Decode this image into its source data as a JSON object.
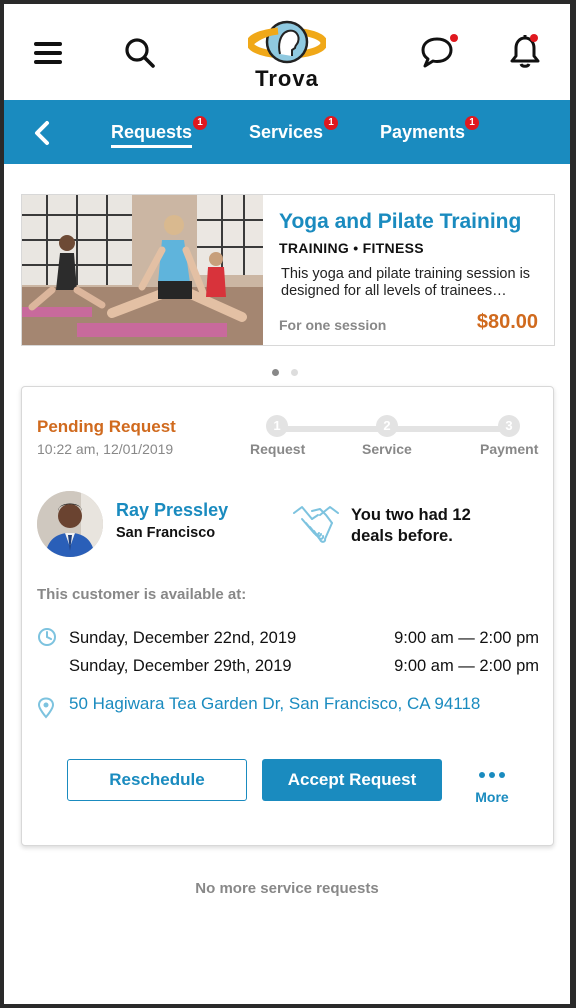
{
  "header": {
    "brand": "Trova",
    "icons": [
      "menu-icon",
      "search-icon",
      "chat-icon",
      "bell-icon"
    ],
    "chat_has_notification": true,
    "bell_has_notification": true
  },
  "nav": {
    "tabs": [
      {
        "label": "Requests",
        "badge": "1",
        "active": true
      },
      {
        "label": "Services",
        "badge": "1",
        "active": false
      },
      {
        "label": "Payments",
        "badge": "1",
        "active": false
      }
    ]
  },
  "promo": {
    "title": "Yoga and Pilate Training",
    "category": "TRAINING • FITNESS",
    "description": "This yoga and pilate training session is designed for all levels of  trainees…",
    "note": "For one session",
    "price": "$80.00",
    "carousel_index": 1,
    "carousel_count": 2
  },
  "request": {
    "status": "Pending Request",
    "time": "10:22 am, 12/01/2019",
    "steps": [
      {
        "num": "1",
        "label": "Request"
      },
      {
        "num": "2",
        "label": "Service"
      },
      {
        "num": "3",
        "label": "Payment"
      }
    ],
    "customer": {
      "name": "Ray Pressley",
      "city": "San Francisco"
    },
    "deals_text": "You two had 12 deals before.",
    "availability_label": "This customer is available at:",
    "slots": [
      {
        "date": "Sunday, December 22nd, 2019",
        "time": "9:00 am — 2:00 pm"
      },
      {
        "date": "Sunday, December 29th, 2019",
        "time": "9:00 am — 2:00 pm"
      }
    ],
    "address": "50 Hagiwara Tea Garden Dr, San Francisco, CA 94118",
    "buttons": {
      "reschedule": "Reschedule",
      "accept": "Accept Request",
      "more": "More"
    }
  },
  "footer_text": "No more service requests",
  "colors": {
    "brand_blue": "#1a8bbf",
    "orange": "#d06a1e",
    "badge_red": "#e0181f"
  }
}
